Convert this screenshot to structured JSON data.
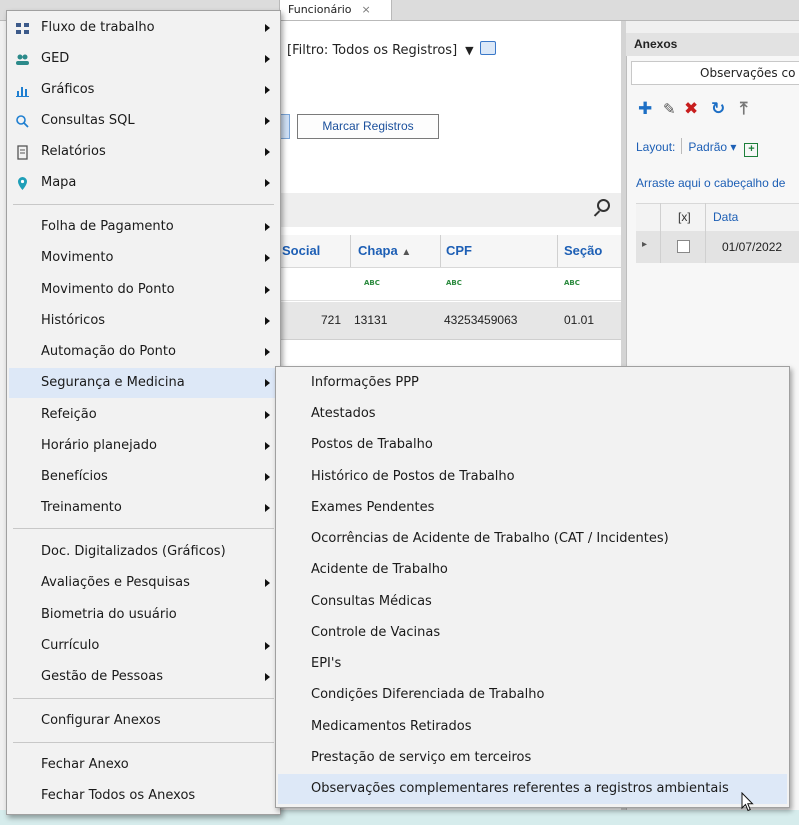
{
  "tabs": [
    {
      "label": ""
    },
    {
      "label": "Funcionário",
      "close": "×"
    }
  ],
  "toolbar": {
    "filter_label": "[Filtro: Todos os Registros]",
    "filter_caret": "▼",
    "mark_button": "Marcar Registros"
  },
  "grid": {
    "columns": [
      "Social",
      "Chapa",
      "CPF",
      "Seção"
    ],
    "sort_indicator": "▲",
    "filter_glyph": "ABC",
    "row": {
      "code": "721",
      "chapa": "13131",
      "cpf": "43253459063",
      "secao": "01.01"
    }
  },
  "attachments": {
    "title": "Anexos",
    "tab_label": "Observações co",
    "layout_label": "Layout:",
    "layout_value": "Padrão ▾",
    "drag_hint": "Arraste aqui o cabeçalho de",
    "col_select": "[x]",
    "col_date": "Data",
    "row_date": "01/07/2022",
    "row_indicator": "▸"
  },
  "menu": {
    "items": [
      {
        "label": "Fluxo de trabalho",
        "icon": "workflow-icon",
        "submenu": true
      },
      {
        "label": "GED",
        "icon": "users-icon",
        "submenu": true
      },
      {
        "label": "Gráficos",
        "icon": "chart-icon",
        "submenu": true
      },
      {
        "label": "Consultas SQL",
        "icon": "search-icon",
        "submenu": true
      },
      {
        "label": "Relatórios",
        "icon": "report-icon",
        "submenu": true
      },
      {
        "label": "Mapa",
        "icon": "map-pin-icon",
        "submenu": true
      },
      {
        "label": "Folha de Pagamento",
        "submenu": true
      },
      {
        "label": "Movimento",
        "submenu": true
      },
      {
        "label": "Movimento do Ponto",
        "submenu": true
      },
      {
        "label": "Históricos",
        "submenu": true
      },
      {
        "label": "Automação do Ponto",
        "submenu": true
      },
      {
        "label": "Segurança e Medicina",
        "submenu": true,
        "highlighted": true
      },
      {
        "label": "Refeição",
        "submenu": true
      },
      {
        "label": "Horário planejado",
        "submenu": true
      },
      {
        "label": "Benefícios",
        "submenu": true
      },
      {
        "label": "Treinamento",
        "submenu": true
      },
      {
        "label": "Doc. Digitalizados (Gráficos)",
        "submenu": false
      },
      {
        "label": "Avaliações e Pesquisas",
        "submenu": true
      },
      {
        "label": "Biometria do usuário",
        "submenu": false
      },
      {
        "label": "Currículo",
        "submenu": true
      },
      {
        "label": "Gestão de Pessoas",
        "submenu": true
      },
      {
        "label": "Configurar Anexos",
        "submenu": false
      },
      {
        "label": "Fechar Anexo",
        "submenu": false
      },
      {
        "label": "Fechar Todos os Anexos",
        "submenu": false
      }
    ]
  },
  "submenu": {
    "items": [
      {
        "label": "Informações PPP"
      },
      {
        "label": "Atestados"
      },
      {
        "label": "Postos de Trabalho"
      },
      {
        "label": "Histórico de Postos de Trabalho"
      },
      {
        "label": "Exames Pendentes"
      },
      {
        "label": "Ocorrências de Acidente de Trabalho (CAT / Incidentes)"
      },
      {
        "label": "Acidente de Trabalho"
      },
      {
        "label": "Consultas Médicas"
      },
      {
        "label": "Controle de Vacinas"
      },
      {
        "label": "EPI's"
      },
      {
        "label": "Condições Diferenciada de Trabalho"
      },
      {
        "label": "Medicamentos Retirados"
      },
      {
        "label": "Prestação de serviço em terceiros"
      },
      {
        "label": "Observações complementares referentes a registros ambientais",
        "highlighted": true
      }
    ]
  },
  "colors": {
    "accent": "#1d5fb5",
    "highlight": "#dde8f7",
    "menu_bg": "#f2f2f2"
  }
}
